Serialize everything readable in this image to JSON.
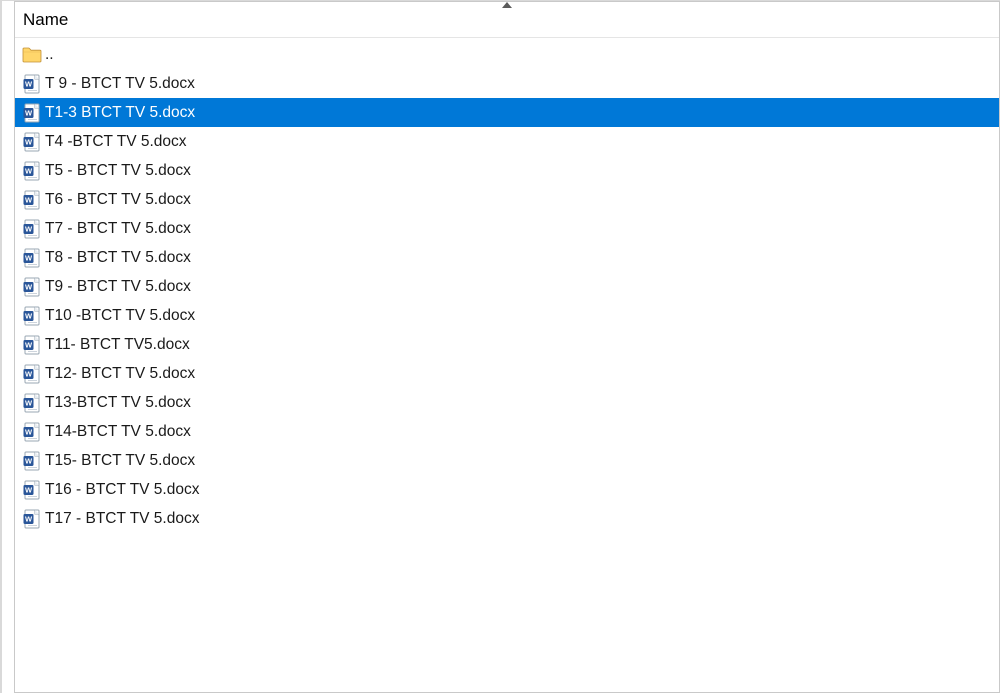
{
  "columns": {
    "name": "Name"
  },
  "parent_label": "..",
  "selected_index": 1,
  "files": [
    {
      "name": "T 9 - BTCT TV 5.docx",
      "type": "docx"
    },
    {
      "name": "T1-3 BTCT TV 5.docx",
      "type": "docx"
    },
    {
      "name": "T4 -BTCT TV 5.docx",
      "type": "docx"
    },
    {
      "name": "T5 - BTCT TV 5.docx",
      "type": "docx"
    },
    {
      "name": "T6 - BTCT TV 5.docx",
      "type": "docx"
    },
    {
      "name": "T7 - BTCT TV 5.docx",
      "type": "docx"
    },
    {
      "name": "T8 - BTCT TV 5.docx",
      "type": "docx"
    },
    {
      "name": "T9 - BTCT TV 5.docx",
      "type": "docx"
    },
    {
      "name": "T10 -BTCT TV 5.docx",
      "type": "docx"
    },
    {
      "name": "T11- BTCT TV5.docx",
      "type": "docx"
    },
    {
      "name": "T12- BTCT TV 5.docx",
      "type": "docx"
    },
    {
      "name": "T13-BTCT TV 5.docx",
      "type": "docx"
    },
    {
      "name": "T14-BTCT TV 5.docx",
      "type": "docx"
    },
    {
      "name": "T15- BTCT TV 5.docx",
      "type": "docx"
    },
    {
      "name": "T16 - BTCT TV 5.docx",
      "type": "docx"
    },
    {
      "name": "T17 - BTCT TV 5.docx",
      "type": "docx"
    }
  ]
}
